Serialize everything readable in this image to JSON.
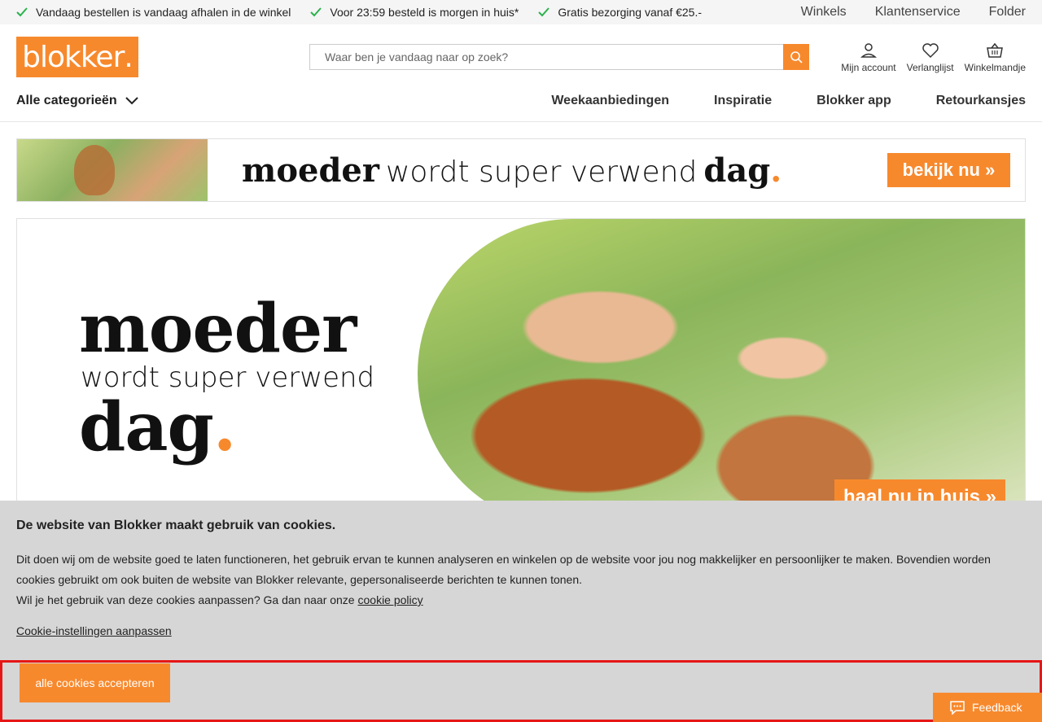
{
  "usp": [
    {
      "text": "Vandaag bestellen is vandaag afhalen in de winkel"
    },
    {
      "text": "Voor 23:59 besteld is morgen in huis*"
    },
    {
      "text": "Gratis bezorging vanaf €25.-"
    }
  ],
  "top_links": [
    "Winkels",
    "Klantenservice",
    "Folder"
  ],
  "logo": {
    "text": "blokker",
    "dot": "."
  },
  "search": {
    "placeholder": "Waar ben je vandaag naar op zoek?"
  },
  "account": {
    "mijn_account": "Mijn account",
    "verlanglijst": "Verlanglijst",
    "winkelmandje": "Winkelmandje"
  },
  "nav": {
    "all_categories": "Alle categorieën",
    "links": [
      "Weekaanbiedingen",
      "Inspiratie",
      "Blokker app",
      "Retourkansjes"
    ]
  },
  "banner_small": {
    "word1": "moeder",
    "word2": "wordt super verwend",
    "word3": "dag",
    "dot": ".",
    "cta": "bekijk nu »"
  },
  "hero": {
    "line1": "moeder",
    "line2": "wordt super verwend",
    "line3": "dag",
    "dot": ".",
    "cta": "haal nu in huis »"
  },
  "cookie": {
    "title": "De website van Blokker maakt gebruik van cookies.",
    "paragraph1": "Dit doen wij om de website goed te laten functioneren, het gebruik ervan te kunnen analyseren en winkelen op de website voor jou nog makkelijker en persoonlijker te maken. Bovendien worden cookies gebruikt om ook buiten de website van Blokker relevante, gepersonaliseerde berichten te kunnen tonen.",
    "paragraph2_prefix": "Wil je het gebruik van deze cookies aanpassen? Ga dan naar onze",
    "policy_link": "cookie policy",
    "settings_link": "Cookie-instellingen aanpassen",
    "accept_button": "alle cookies accepteren"
  },
  "feedback": {
    "label": "Feedback"
  },
  "colors": {
    "brand_orange": "#f7892d",
    "check_green": "#2bb24c",
    "highlight_red": "#e61616",
    "cookie_bg": "#d6d6d6"
  }
}
